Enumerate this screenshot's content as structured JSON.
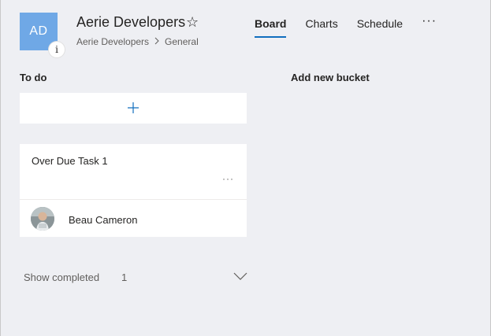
{
  "header": {
    "avatar_initials": "AD",
    "info_glyph": "i",
    "title": "Aerie Developers",
    "favorite_icon": "star-outline-icon",
    "breadcrumb": {
      "group": "Aerie Developers",
      "channel": "General"
    }
  },
  "tabs": [
    {
      "label": "Board",
      "active": true
    },
    {
      "label": "Charts",
      "active": false
    },
    {
      "label": "Schedule",
      "active": false
    }
  ],
  "more_label": "···",
  "board": {
    "bucket_title": "To do",
    "add_new_bucket": "Add new bucket",
    "add_task_symbol": "+",
    "task": {
      "title": "Over Due Task 1",
      "more": "···",
      "assignee": "Beau Cameron"
    },
    "show_completed_label": "Show completed",
    "completed_count": "1"
  },
  "colors": {
    "accent": "#106ebe",
    "avatar_bg": "#6fa8e6",
    "background": "#eeeff3"
  }
}
